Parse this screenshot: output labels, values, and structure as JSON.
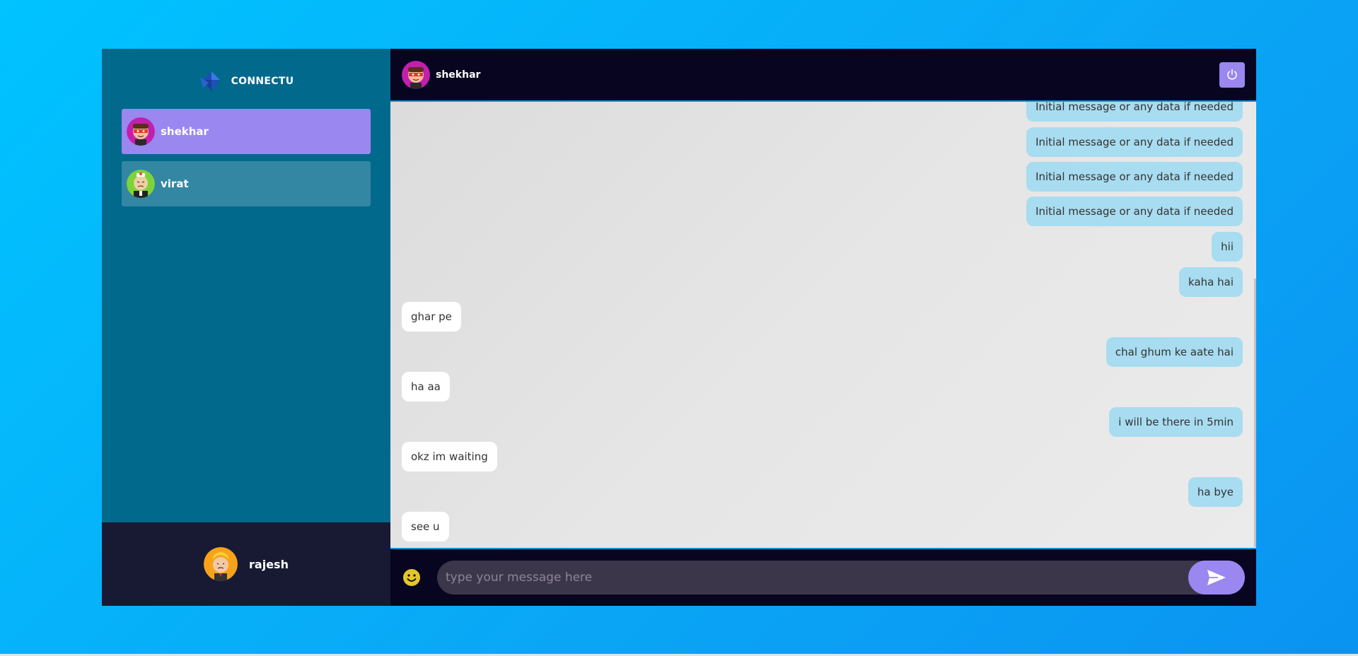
{
  "brand": {
    "name": "CONNECTU",
    "logo_icon": "diamond-logo-icon"
  },
  "contacts": [
    {
      "name": "shekhar",
      "avatar": "avatar-shekhar",
      "selected": true
    },
    {
      "name": "virat",
      "avatar": "avatar-virat",
      "selected": false
    }
  ],
  "current_user": {
    "name": "rajesh",
    "avatar": "avatar-rajesh"
  },
  "chat": {
    "header_name": "shekhar",
    "logout_icon": "power-icon",
    "messages": [
      {
        "text": "Initial message or any data if needed",
        "from": "me"
      },
      {
        "text": "Initial message or any data if needed",
        "from": "me"
      },
      {
        "text": "Initial message or any data if needed",
        "from": "me"
      },
      {
        "text": "Initial message or any data if needed",
        "from": "me"
      },
      {
        "text": "hii",
        "from": "me"
      },
      {
        "text": "kaha hai",
        "from": "me"
      },
      {
        "text": "ghar pe",
        "from": "them"
      },
      {
        "text": "chal ghum ke aate hai",
        "from": "me"
      },
      {
        "text": "ha aa",
        "from": "them"
      },
      {
        "text": "i will be there in 5min",
        "from": "me"
      },
      {
        "text": "okz im waiting",
        "from": "them"
      },
      {
        "text": "ha bye",
        "from": "me"
      },
      {
        "text": "see u",
        "from": "them"
      }
    ]
  },
  "composer": {
    "placeholder": "type your message here",
    "emoji_icon": "smiley-icon",
    "send_icon": "send-icon"
  },
  "colors": {
    "background": "#00c3ff",
    "sidebar": "#00698c",
    "selected": "#9a87f0",
    "sent_bubble": "#a8dcf0",
    "received_bubble": "#ffffff",
    "dark": "#080521"
  }
}
